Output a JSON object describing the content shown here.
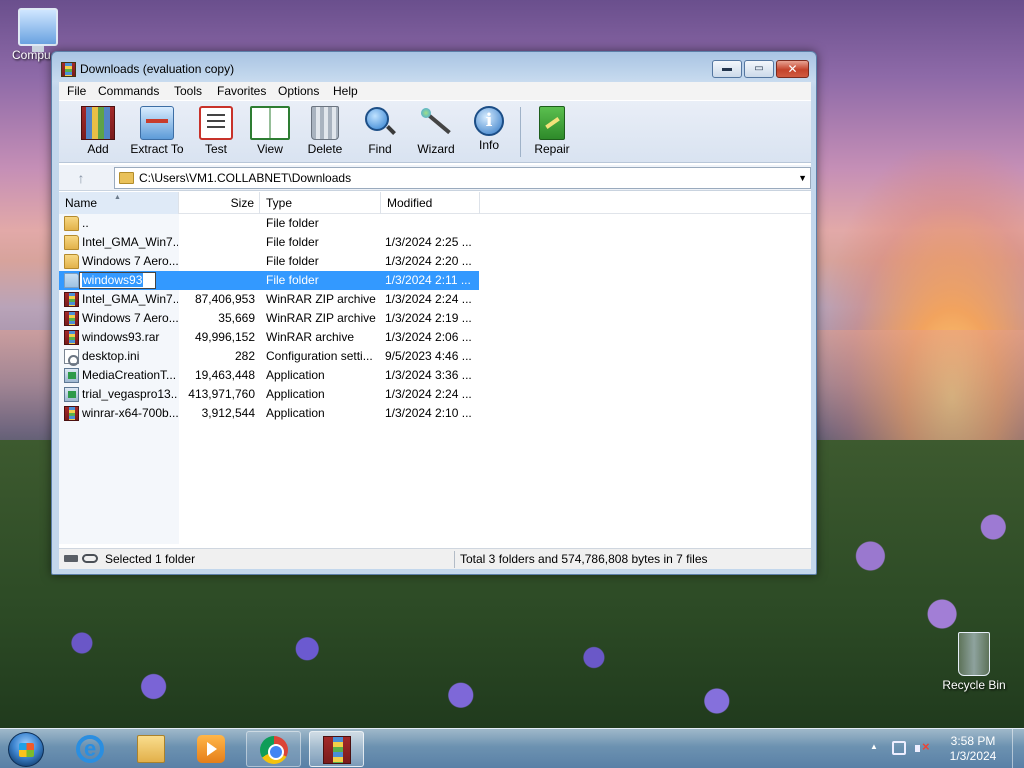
{
  "desktop": {
    "icons": [
      {
        "label": "Compu"
      },
      {
        "label": "Recycle Bin"
      }
    ]
  },
  "window": {
    "title": "Downloads (evaluation copy)",
    "controls": {
      "minimize": "▬",
      "maximize": "▭",
      "close": "✕"
    }
  },
  "menu": [
    "File",
    "Commands",
    "Tools",
    "Favorites",
    "Options",
    "Help"
  ],
  "toolbar": [
    {
      "label": "Add",
      "icon": "add-archive-icon"
    },
    {
      "label": "Extract To",
      "icon": "extract-to-icon"
    },
    {
      "label": "Test",
      "icon": "test-icon"
    },
    {
      "label": "View",
      "icon": "view-book-icon"
    },
    {
      "label": "Delete",
      "icon": "trash-icon"
    },
    {
      "label": "Find",
      "icon": "magnifier-icon"
    },
    {
      "label": "Wizard",
      "icon": "wand-icon"
    },
    {
      "label": "Info",
      "icon": "info-icon"
    },
    {
      "label": "Repair",
      "icon": "repair-kit-icon"
    }
  ],
  "address": {
    "path": "C:\\Users\\VM1.COLLABNET\\Downloads",
    "up_glyph": "↑"
  },
  "columns": {
    "name": "Name",
    "size": "Size",
    "type": "Type",
    "modified": "Modified"
  },
  "files": [
    {
      "name": "..",
      "size": "",
      "type": "File folder",
      "modified": "",
      "icon": "folder-icon"
    },
    {
      "name": "Intel_GMA_Win7...",
      "size": "",
      "type": "File folder",
      "modified": "1/3/2024 2:25 ...",
      "icon": "folder-icon"
    },
    {
      "name": "Windows 7 Aero...",
      "size": "",
      "type": "File folder",
      "modified": "1/3/2024 2:20 ...",
      "icon": "folder-icon"
    },
    {
      "name": "windows93",
      "size": "",
      "type": "File folder",
      "modified": "1/3/2024 2:11 ...",
      "icon": "folder-icon",
      "selected": true,
      "renaming": true
    },
    {
      "name": "Intel_GMA_Win7...",
      "size": "87,406,953",
      "type": "WinRAR ZIP archive",
      "modified": "1/3/2024 2:24 ...",
      "icon": "rar-archive-icon"
    },
    {
      "name": "Windows 7 Aero...",
      "size": "35,669",
      "type": "WinRAR ZIP archive",
      "modified": "1/3/2024 2:19 ...",
      "icon": "rar-archive-icon"
    },
    {
      "name": "windows93.rar",
      "size": "49,996,152",
      "type": "WinRAR archive",
      "modified": "1/3/2024 2:06 ...",
      "icon": "rar-archive-icon"
    },
    {
      "name": "desktop.ini",
      "size": "282",
      "type": "Configuration setti...",
      "modified": "9/5/2023 4:46 ...",
      "icon": "ini-file-icon"
    },
    {
      "name": "MediaCreationT...",
      "size": "19,463,448",
      "type": "Application",
      "modified": "1/3/2024 3:36 ...",
      "icon": "application-icon"
    },
    {
      "name": "trial_vegaspro13...",
      "size": "413,971,760",
      "type": "Application",
      "modified": "1/3/2024 2:24 ...",
      "icon": "application-icon"
    },
    {
      "name": "winrar-x64-700b...",
      "size": "3,912,544",
      "type": "Application",
      "modified": "1/3/2024 2:10 ...",
      "icon": "rar-archive-icon"
    }
  ],
  "status": {
    "left": "Selected 1 folder",
    "right": "Total 3 folders and 574,786,808 bytes in 7 files"
  },
  "taskbar": {
    "clock_time": "3:58 PM",
    "clock_date": "1/3/2024"
  }
}
